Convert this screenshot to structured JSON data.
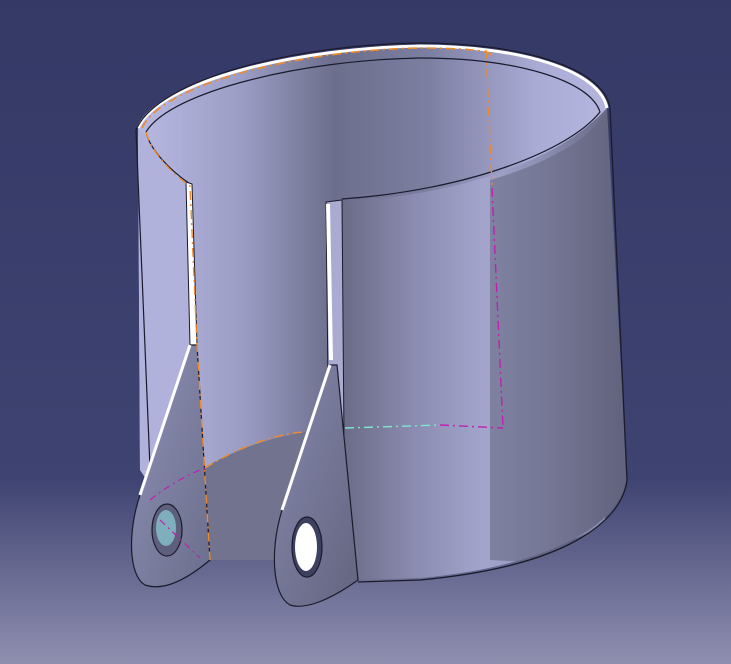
{
  "viewport": {
    "background_top": "#353966",
    "background_mid": "#3f4371",
    "background_bottom": "#8f8fb0"
  },
  "model": {
    "part": "sheet-metal-pipe-clamp",
    "colors": {
      "outer_light": "#9a9cc2",
      "outer_mid": "#8c8db2",
      "outer_dark": "#6a6b86",
      "inner_light": "#b4b6df",
      "inner_dark": "#6c6e8c",
      "edge_highlight": "#ffffff",
      "edge_outline": "#1b1b2c",
      "axis_orange": "#f08a2a",
      "axis_magenta": "#c01fb0",
      "axis_cyan": "#7fe7d0"
    }
  }
}
